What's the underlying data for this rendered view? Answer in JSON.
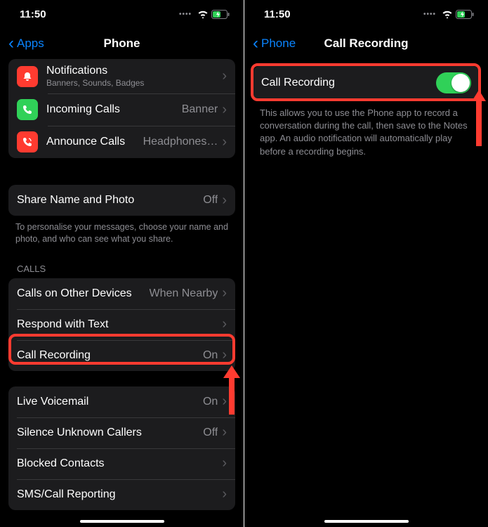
{
  "status": {
    "time": "11:50"
  },
  "left": {
    "back": "Apps",
    "title": "Phone",
    "notif": {
      "label": "Notifications",
      "sub": "Banners, Sounds, Badges"
    },
    "incoming": {
      "label": "Incoming Calls",
      "value": "Banner"
    },
    "announce": {
      "label": "Announce Calls",
      "value": "Headphones…"
    },
    "share": {
      "label": "Share Name and Photo",
      "value": "Off"
    },
    "share_footer": "To personalise your messages, choose your name and photo, and who can see what you share.",
    "calls_header": "CALLS",
    "other_devices": {
      "label": "Calls on Other Devices",
      "value": "When Nearby"
    },
    "respond": {
      "label": "Respond with Text"
    },
    "recording": {
      "label": "Call Recording",
      "value": "On"
    },
    "voicemail": {
      "label": "Live Voicemail",
      "value": "On"
    },
    "silence": {
      "label": "Silence Unknown Callers",
      "value": "Off"
    },
    "blocked": {
      "label": "Blocked Contacts"
    },
    "sms": {
      "label": "SMS/Call Reporting"
    }
  },
  "right": {
    "back": "Phone",
    "title": "Call Recording",
    "toggle_label": "Call Recording",
    "desc": "This allows you to use the Phone app to record a conversation during the call, then save to the Notes app. An audio notification will automatically play before a recording begins."
  },
  "colors": {
    "notif_icon": "#ff3b30",
    "incoming_icon": "#30d158",
    "announce_icon": "#ff3b30"
  }
}
